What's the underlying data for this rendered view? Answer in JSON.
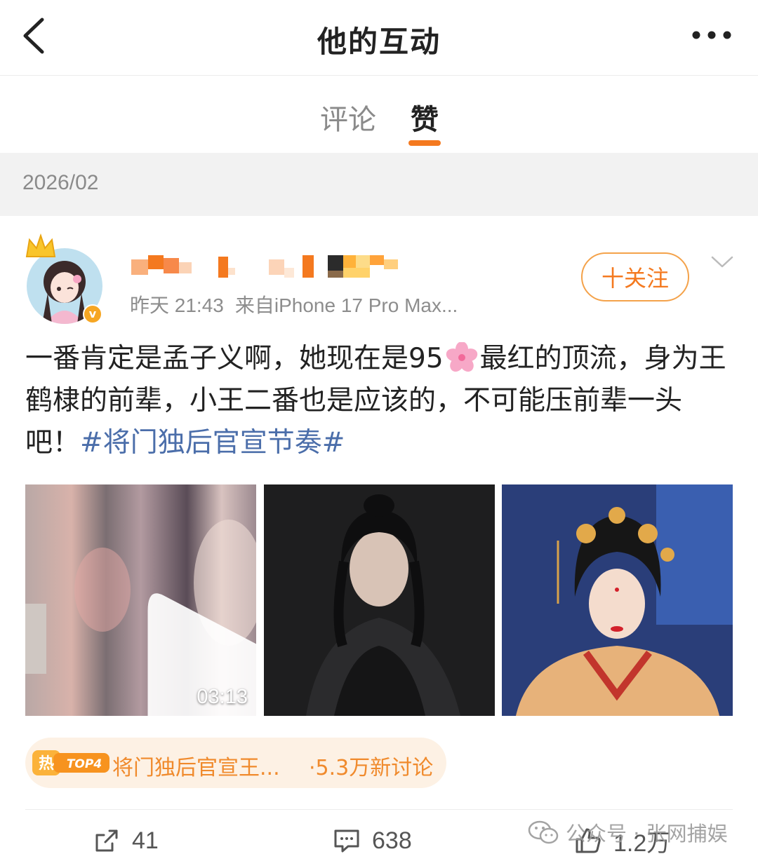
{
  "nav": {
    "title": "他的互动",
    "back_icon": "chevron-left-icon",
    "more_icon": "more-dots-icon"
  },
  "tabs": [
    {
      "label": "评论",
      "active": false
    },
    {
      "label": "赞",
      "active": true
    }
  ],
  "accent_color": "#f4791f",
  "date_group": "2026/02",
  "post": {
    "username": "",
    "time": "昨天 21:43",
    "source": "来自iPhone 17 Pro Max...",
    "follow_label": "十关注",
    "text_parts": [
      "一番肯定是孟子义啊，她现在是95",
      "最红的顶流，身为王鹤棣的前辈，小王二番也是应该的，不可能压前辈一头吧！"
    ],
    "hashtag": "#将门独后官宣节奏#",
    "media": [
      {
        "type": "video",
        "duration": "03:13"
      },
      {
        "type": "image"
      },
      {
        "type": "image"
      }
    ],
    "hot_topic": {
      "badge": "热",
      "rank": "TOP4",
      "title": "将门独后官宣王...",
      "discussion": "·5.3万新讨论"
    },
    "actions": {
      "share_count": "41",
      "comment_count": "638",
      "like_count": "1.2万"
    }
  },
  "watermark": "公众号 · 张网捕娱"
}
